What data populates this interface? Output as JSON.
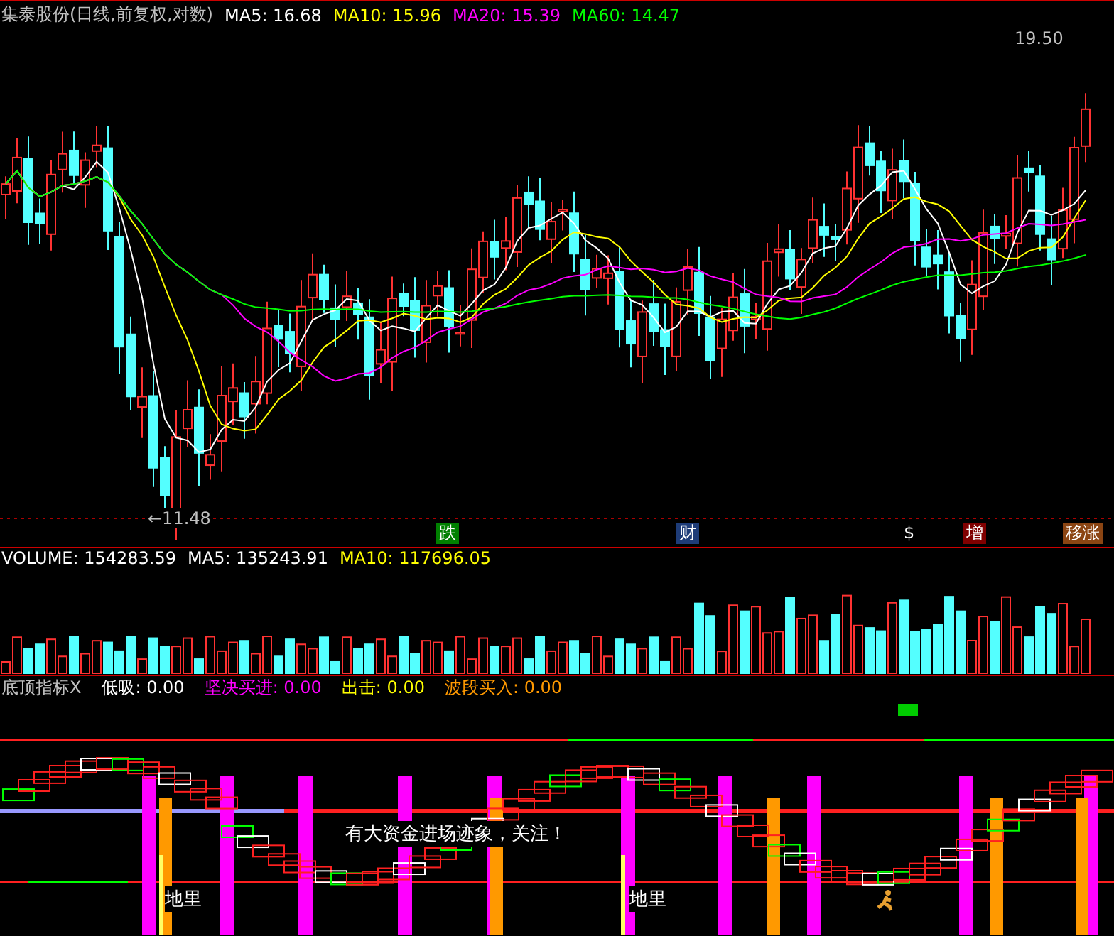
{
  "price_panel": {
    "title": "集泰股份(日线,前复权,对数)",
    "indicators": [
      {
        "label": "MA5:",
        "value": "16.68",
        "color": "#ffffff"
      },
      {
        "label": "MA10:",
        "value": "15.96",
        "color": "#ffff00"
      },
      {
        "label": "MA20:",
        "value": "15.39",
        "color": "#ff00ff"
      },
      {
        "label": "MA60:",
        "value": "14.47",
        "color": "#00ff00"
      }
    ],
    "high_label": "19.50",
    "low_label": "←11.48",
    "event_tags": [
      {
        "text": "跌",
        "color": "#008000"
      },
      {
        "text": "财",
        "color": "#1e3c78"
      },
      {
        "text": "$",
        "color": "#000000"
      },
      {
        "text": "增",
        "color": "#800000"
      },
      {
        "text": "移涨",
        "color": "#8b4513"
      }
    ]
  },
  "volume_panel": {
    "indicators": [
      {
        "label": "VOLUME:",
        "value": "154283.59",
        "color": "#ffffff"
      },
      {
        "label": "MA5:",
        "value": "135243.91",
        "color": "#ffffff"
      },
      {
        "label": "MA10:",
        "value": "117696.05",
        "color": "#ffff00"
      }
    ]
  },
  "signal_panel": {
    "title": "底顶指标X",
    "indicators": [
      {
        "label": "低吸:",
        "value": "0.00",
        "color": "#ffffff"
      },
      {
        "label": "坚决买进:",
        "value": "0.00",
        "color": "#ff00ff"
      },
      {
        "label": "出击:",
        "value": "0.00",
        "color": "#ffff00"
      },
      {
        "label": "波段买入:",
        "value": "0.00",
        "color": "#ff9900"
      }
    ],
    "message": "有大资金进场迹象，关注！",
    "tags": [
      "地里",
      "地里"
    ]
  }
}
